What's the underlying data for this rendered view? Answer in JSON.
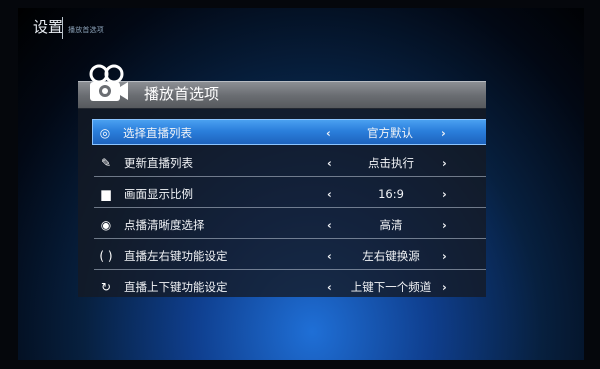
{
  "header": {
    "title": "设置",
    "subtitle": "播放首选项"
  },
  "panel": {
    "title": "播放首选项",
    "icon": "camera-icon"
  },
  "settings": [
    {
      "label": "选择直播列表",
      "value": "官方默认",
      "icon": "swirl-icon",
      "selected": true
    },
    {
      "label": "更新直播列表",
      "value": "点击执行",
      "icon": "broom-icon",
      "selected": false
    },
    {
      "label": "画面显示比例",
      "value": "16:9",
      "icon": "aspect-ratio-icon",
      "selected": false
    },
    {
      "label": "点播清晰度选择",
      "value": "高清",
      "icon": "eye-icon",
      "selected": false
    },
    {
      "label": "直播左右键功能设定",
      "value": "左右键换源",
      "icon": "brackets-icon",
      "selected": false
    },
    {
      "label": "直播上下键功能设定",
      "value": "上键下一个频道",
      "icon": "refresh-icon",
      "selected": false
    }
  ],
  "arrows": {
    "left": "‹",
    "right": "›"
  },
  "colors": {
    "selected_row": "#2b7fdc",
    "header_bar": "#6a6d72"
  }
}
